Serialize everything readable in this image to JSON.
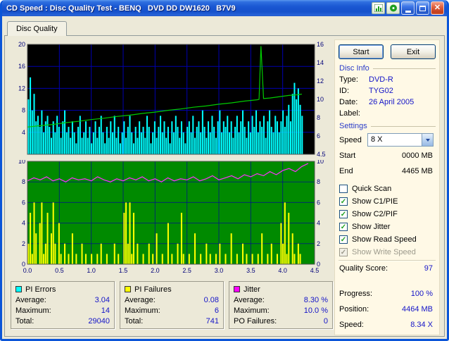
{
  "window": {
    "title": "CD Speed : Disc Quality Test - BENQ   DVD DD DW1620   B7V9",
    "tool_icons": [
      {
        "name": "graph-icon"
      },
      {
        "name": "disc-icon"
      }
    ],
    "controls": [
      {
        "name": "minimize-icon"
      },
      {
        "name": "maximize-icon"
      },
      {
        "name": "close-icon"
      }
    ]
  },
  "glyphs": {
    "close": "✕",
    "check": "✓"
  },
  "tab": {
    "label": "Disc Quality"
  },
  "panel": {
    "start_button": "Start",
    "exit_button": "Exit",
    "disc_info": {
      "header": "Disc Info",
      "rows": [
        {
          "label": "Type:",
          "value": "DVD-R"
        },
        {
          "label": "ID:",
          "value": "TYG02"
        },
        {
          "label": "Date:",
          "value": "26 April 2005"
        },
        {
          "label": "Label:",
          "value": ""
        }
      ]
    },
    "settings": {
      "header": "Settings",
      "speed": {
        "label": "Speed",
        "value": "8 X"
      },
      "fields": [
        {
          "label": "Start",
          "value": "0000 MB"
        },
        {
          "label": "End",
          "value": "4465 MB"
        }
      ],
      "checkboxes": [
        {
          "label": "Quick Scan",
          "checked": false,
          "enabled": true
        },
        {
          "label": "Show C1/PIE",
          "checked": true,
          "enabled": true
        },
        {
          "label": "Show C2/PIF",
          "checked": true,
          "enabled": true
        },
        {
          "label": "Show Jitter",
          "checked": true,
          "enabled": true
        },
        {
          "label": "Show Read Speed",
          "checked": true,
          "enabled": true
        },
        {
          "label": "Show Write Speed",
          "checked": true,
          "enabled": false
        }
      ]
    },
    "results": [
      {
        "label": "Quality Score:",
        "value": "97"
      },
      {
        "label": "Progress:",
        "value": "100 %"
      },
      {
        "label": "Position:",
        "value": "4464 MB"
      },
      {
        "label": "Speed:",
        "value": "8.34 X"
      }
    ]
  },
  "stats_boxes": [
    {
      "title": "PI Errors",
      "color": "#00FFFF",
      "rows": [
        {
          "label": "Average:",
          "value": "3.04"
        },
        {
          "label": "Maximum:",
          "value": "14"
        },
        {
          "label": "Total:",
          "value": "29040"
        }
      ]
    },
    {
      "title": "PI Failures",
      "color": "#FFFF00",
      "rows": [
        {
          "label": "Average:",
          "value": "0.08"
        },
        {
          "label": "Maximum:",
          "value": "6"
        },
        {
          "label": "Total:",
          "value": "741"
        }
      ]
    },
    {
      "title": "Jitter",
      "color": "#FF00FF",
      "rows": [
        {
          "label": "Average:",
          "value": "8.30 %"
        },
        {
          "label": "Maximum:",
          "value": "10.0 %"
        },
        {
          "label": "PO Failures:",
          "value": "0"
        }
      ]
    }
  ],
  "chart_data": [
    {
      "type": "bar",
      "name": "pi-errors-chart",
      "title": "PI Errors and Read Speed",
      "x_max": 4.5,
      "ylim": [
        0,
        20
      ],
      "grid_step": 4,
      "bg": "#000000",
      "grid_color": "#0000B0",
      "grid_opacity": 1,
      "left_ticks": [
        20,
        16,
        12,
        8,
        4
      ],
      "right_ticks": [
        "16",
        "14",
        "12",
        "10",
        "8",
        "6",
        "4.5"
      ],
      "right_even": true,
      "series": [
        {
          "name": "PI Errors",
          "type": "bar",
          "color": "#00FFFF",
          "x_start": 0.015,
          "x_step": 0.03,
          "values": [
            10,
            14,
            8,
            11,
            6,
            7,
            5,
            8,
            4,
            6,
            7,
            5,
            3,
            6,
            4,
            7,
            5,
            3,
            6,
            8,
            4,
            5,
            3,
            6,
            4,
            2,
            5,
            7,
            3,
            4,
            6,
            3,
            5,
            2,
            4,
            6,
            3,
            5,
            7,
            4,
            2,
            5,
            3,
            6,
            4,
            7,
            3,
            5,
            2,
            4,
            6,
            3,
            5,
            7,
            4,
            2,
            5,
            3,
            6,
            4,
            5,
            3,
            7,
            5,
            2,
            4,
            6,
            3,
            5,
            7,
            4,
            6,
            3,
            5,
            2,
            6,
            4,
            7,
            5,
            3,
            6,
            4,
            2,
            5,
            6,
            4,
            7,
            3,
            5,
            6,
            4,
            8,
            5,
            3,
            6,
            4,
            7,
            5,
            3,
            6,
            8,
            4,
            6,
            5,
            7,
            4,
            6,
            3,
            5,
            7,
            4,
            6,
            8,
            5,
            3,
            6,
            4,
            7,
            5,
            8,
            4,
            6,
            5,
            7,
            3,
            6,
            8,
            5,
            4,
            7,
            6,
            4,
            6,
            8,
            5,
            7,
            9,
            6,
            11,
            13,
            10,
            12,
            9,
            7
          ]
        },
        {
          "name": "Read Speed",
          "type": "line",
          "color": "#00CC00",
          "scale_min": 1.5,
          "scale_max": 14,
          "points": [
            [
              0,
              4.6
            ],
            [
              0.2,
              4.75
            ],
            [
              0.4,
              4.9
            ],
            [
              0.6,
              5.1
            ],
            [
              0.8,
              5.25
            ],
            [
              1.0,
              5.45
            ],
            [
              1.2,
              5.6
            ],
            [
              1.4,
              5.8
            ],
            [
              1.6,
              5.95
            ],
            [
              1.8,
              6.15
            ],
            [
              2.0,
              6.3
            ],
            [
              2.2,
              6.5
            ],
            [
              2.4,
              6.65
            ],
            [
              2.6,
              6.85
            ],
            [
              2.8,
              7.0
            ],
            [
              3.0,
              7.2
            ],
            [
              3.2,
              7.35
            ],
            [
              3.4,
              7.55
            ],
            [
              3.6,
              7.7
            ],
            [
              3.63,
              7.75
            ],
            [
              3.66,
              13.8
            ],
            [
              3.7,
              7.85
            ],
            [
              3.8,
              7.9
            ],
            [
              4.0,
              8.1
            ],
            [
              4.1,
              8.2
            ],
            [
              4.2,
              8.25
            ],
            [
              4.3,
              8.34
            ]
          ]
        }
      ]
    },
    {
      "type": "bar",
      "name": "pi-failures-chart",
      "title": "PI Failures and Jitter",
      "x_max": 4.5,
      "ylim": [
        0,
        10
      ],
      "grid_step": 2,
      "bg": "#008A00",
      "grid_color": "#0000A0",
      "grid_opacity": 0.65,
      "left_ticks": [
        10,
        8,
        6,
        4,
        2,
        0
      ],
      "right_ticks": [
        "10",
        "8",
        "6",
        "4",
        "2",
        "0"
      ],
      "right_even": false,
      "x_ticks": [
        "0.0",
        "0.5",
        "1.0",
        "1.5",
        "2.0",
        "2.5",
        "3.0",
        "3.5",
        "4.0",
        "4.5"
      ],
      "series": [
        {
          "name": "PI Failures",
          "type": "bar",
          "color": "#FFFF00",
          "x_start": 0.015,
          "x_step": 0.03,
          "values": [
            2,
            5,
            1,
            6,
            3,
            0,
            4,
            6,
            1,
            2,
            5,
            0,
            3,
            6,
            2,
            0,
            4,
            1,
            0,
            2,
            0,
            1,
            0,
            3,
            0,
            1,
            0,
            0,
            2,
            0,
            1,
            0,
            0,
            1,
            0,
            0,
            1,
            0,
            2,
            0,
            0,
            1,
            0,
            0,
            0,
            2,
            0,
            1,
            0,
            0,
            5,
            6,
            2,
            6,
            1,
            5,
            0,
            2,
            0,
            0,
            1,
            0,
            0,
            2,
            0,
            1,
            0,
            3,
            0,
            0,
            1,
            0,
            0,
            4,
            0,
            1,
            0,
            0,
            2,
            0,
            5,
            1,
            0,
            0,
            1,
            0,
            0,
            3,
            0,
            0,
            1,
            0,
            0,
            2,
            0,
            1,
            0,
            0,
            1,
            0,
            2,
            0,
            0,
            1,
            0,
            0,
            3,
            0,
            0,
            1,
            0,
            0,
            2,
            0,
            1,
            0,
            0,
            1,
            0,
            0,
            1,
            0,
            3,
            0,
            0,
            1,
            0,
            2,
            0,
            0,
            1,
            0,
            4,
            2,
            6,
            1,
            5,
            0,
            3,
            1,
            0,
            2,
            1,
            0
          ]
        },
        {
          "name": "Jitter",
          "type": "line",
          "color": "#FF30FF",
          "points": [
            [
              0,
              8.1
            ],
            [
              0.1,
              8.4
            ],
            [
              0.2,
              8.2
            ],
            [
              0.3,
              8.5
            ],
            [
              0.4,
              8.1
            ],
            [
              0.5,
              8.3
            ],
            [
              0.6,
              8.0
            ],
            [
              0.7,
              8.4
            ],
            [
              0.8,
              8.2
            ],
            [
              0.9,
              8.3
            ],
            [
              1.0,
              8.1
            ],
            [
              1.1,
              8.5
            ],
            [
              1.2,
              8.2
            ],
            [
              1.3,
              8.0
            ],
            [
              1.4,
              8.3
            ],
            [
              1.5,
              8.1
            ],
            [
              1.6,
              8.4
            ],
            [
              1.7,
              8.2
            ],
            [
              1.8,
              8.5
            ],
            [
              1.9,
              8.1
            ],
            [
              2.0,
              8.3
            ],
            [
              2.1,
              8.0
            ],
            [
              2.2,
              8.4
            ],
            [
              2.3,
              8.1
            ],
            [
              2.4,
              8.3
            ],
            [
              2.5,
              8.2
            ],
            [
              2.6,
              8.5
            ],
            [
              2.7,
              8.1
            ],
            [
              2.8,
              8.3
            ],
            [
              2.9,
              8.6
            ],
            [
              3.0,
              8.2
            ],
            [
              3.1,
              8.4
            ],
            [
              3.2,
              8.6
            ],
            [
              3.3,
              8.3
            ],
            [
              3.4,
              8.7
            ],
            [
              3.5,
              8.5
            ],
            [
              3.6,
              8.8
            ],
            [
              3.7,
              8.6
            ],
            [
              3.8,
              9.0
            ],
            [
              3.9,
              8.7
            ],
            [
              4.0,
              9.1
            ],
            [
              4.1,
              9.3
            ],
            [
              4.2,
              9.0
            ],
            [
              4.3,
              9.5
            ],
            [
              4.4,
              9.8
            ]
          ]
        }
      ]
    }
  ]
}
